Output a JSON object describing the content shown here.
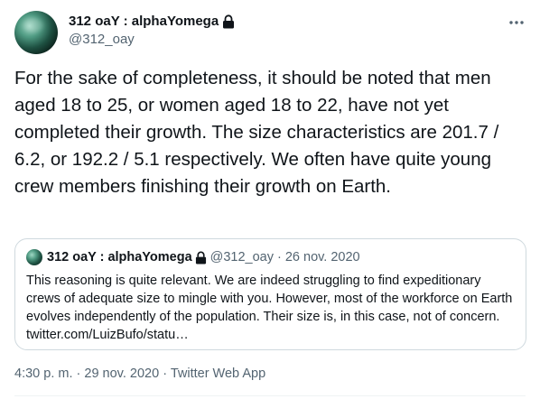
{
  "author": {
    "display_name": "312 oaY : alphaYomega",
    "handle": "@312_oay",
    "protected_icon": "lock-icon"
  },
  "menu": {
    "icon": "more-horizontal-icon"
  },
  "tweet": {
    "text": "For the sake of completeness, it should be noted that men aged 18 to 25, or women aged 18 to 22, have not yet completed their growth. The size characteristics are 201.7 / 6.2, or 192.2 / 5.1 respectively. We often have quite young crew members finishing their growth on Earth."
  },
  "quoted_tweet": {
    "display_name": "312 oaY : alphaYomega",
    "handle": "@312_oay",
    "separator": "·",
    "date": "26 nov. 2020",
    "text": "This reasoning is quite relevant. We are indeed struggling to find expeditionary crews of adequate size to mingle with you. However, most of the workforce on Earth evolves independently of the population. Their size is, in this case, not of concern. twitter.com/LuizBufo/statu…"
  },
  "meta": {
    "time": "4:30 p. m.",
    "separator1": "·",
    "date": "29 nov. 2020",
    "separator2": "·",
    "source": "Twitter Web App"
  },
  "colors": {
    "text": "#0f1419",
    "secondary": "#536471",
    "border": "#cfd9de"
  }
}
